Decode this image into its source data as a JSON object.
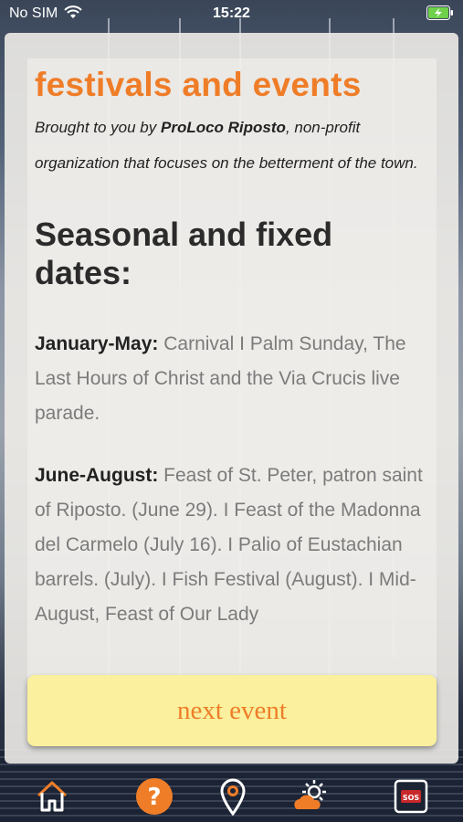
{
  "status_bar": {
    "carrier": "No SIM",
    "time": "15:22"
  },
  "content": {
    "title": "festivals and events",
    "intro": {
      "prefix": "Brought to you by ",
      "org": "ProLoco Riposto",
      "suffix": ", non-profit organization that focuses on the betterment of the town."
    },
    "section_title": "Seasonal and fixed dates:",
    "entries": [
      {
        "label": "January-May:",
        "text": " Carnival I Palm Sunday, The Last Hours of Christ and the Via Crucis live parade."
      },
      {
        "label": "June-August:",
        "text": " Feast of St. Peter, patron saint of Riposto. (June 29). I Feast of the Madonna del Carmelo (July 16). I Palio of Eustachian barrels. (July). I Fish Festival (August). I Mid-August, Feast of Our Lady"
      }
    ]
  },
  "next_button": {
    "label": "next event"
  },
  "tabbar": {
    "items": [
      {
        "icon": "home-icon"
      },
      {
        "icon": "help-icon"
      },
      {
        "icon": "map-pin-icon"
      },
      {
        "icon": "weather-icon"
      },
      {
        "icon": "sos-icon",
        "label": "SOS"
      }
    ]
  },
  "colors": {
    "accent": "#ef7d28",
    "button_bg": "#faf09d",
    "battery": "#6fd14a"
  }
}
